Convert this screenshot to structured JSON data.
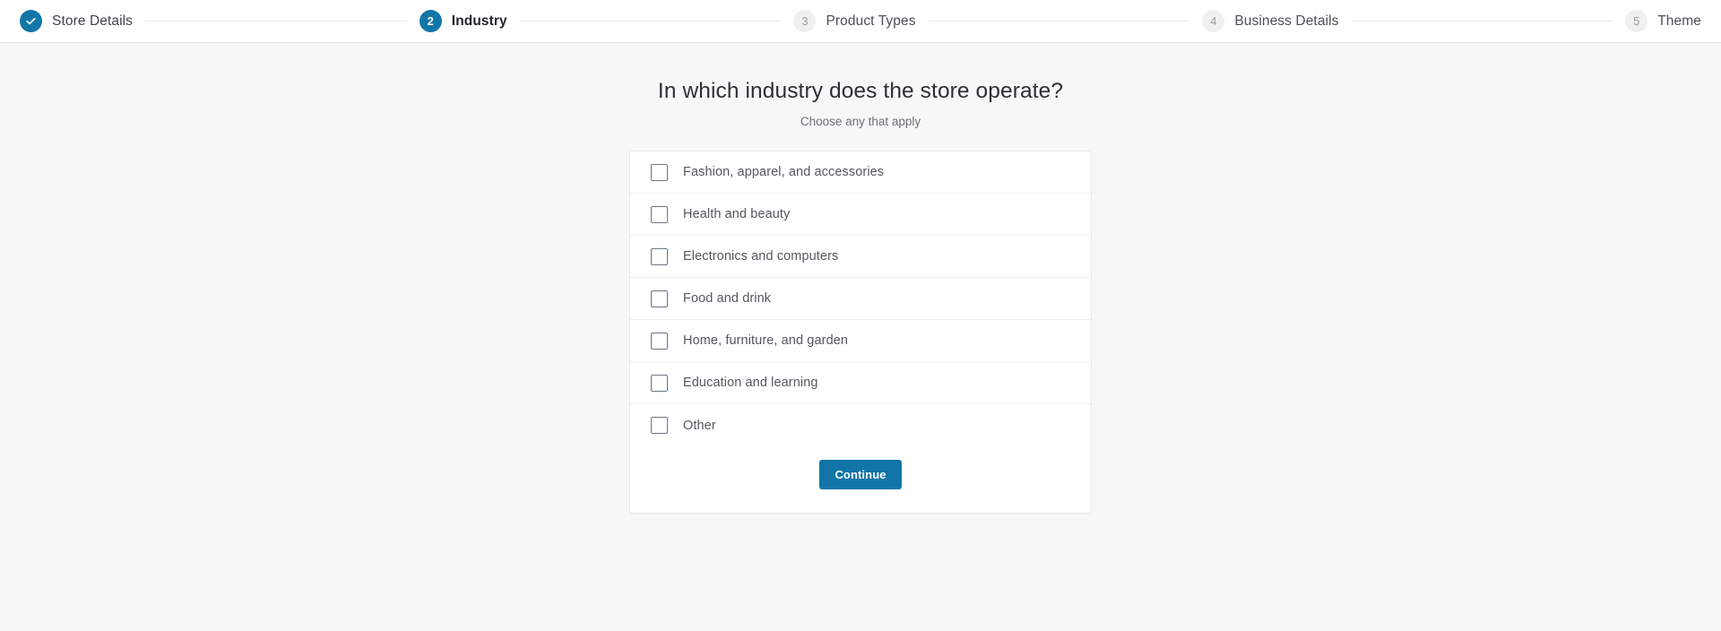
{
  "header": {
    "steps": [
      {
        "number": "1",
        "label": "Store Details",
        "state": "done",
        "icon": "check-icon"
      },
      {
        "number": "2",
        "label": "Industry",
        "state": "current"
      },
      {
        "number": "3",
        "label": "Product Types",
        "state": "todo"
      },
      {
        "number": "4",
        "label": "Business Details",
        "state": "todo"
      },
      {
        "number": "5",
        "label": "Theme",
        "state": "todo"
      }
    ]
  },
  "main": {
    "title": "In which industry does the store operate?",
    "subtitle": "Choose any that apply",
    "industries": [
      {
        "label": "Fashion, apparel, and accessories",
        "checked": false
      },
      {
        "label": "Health and beauty",
        "checked": false
      },
      {
        "label": "Electronics and computers",
        "checked": false
      },
      {
        "label": "Food and drink",
        "checked": false
      },
      {
        "label": "Home, furniture, and garden",
        "checked": false
      },
      {
        "label": "Education and learning",
        "checked": false
      },
      {
        "label": "Other",
        "checked": false
      }
    ],
    "continue_label": "Continue"
  },
  "colors": {
    "accent": "#1275a8",
    "page_background": "#f6f7f7",
    "card_background": "#ffffff",
    "divider": "#eeeeee"
  }
}
